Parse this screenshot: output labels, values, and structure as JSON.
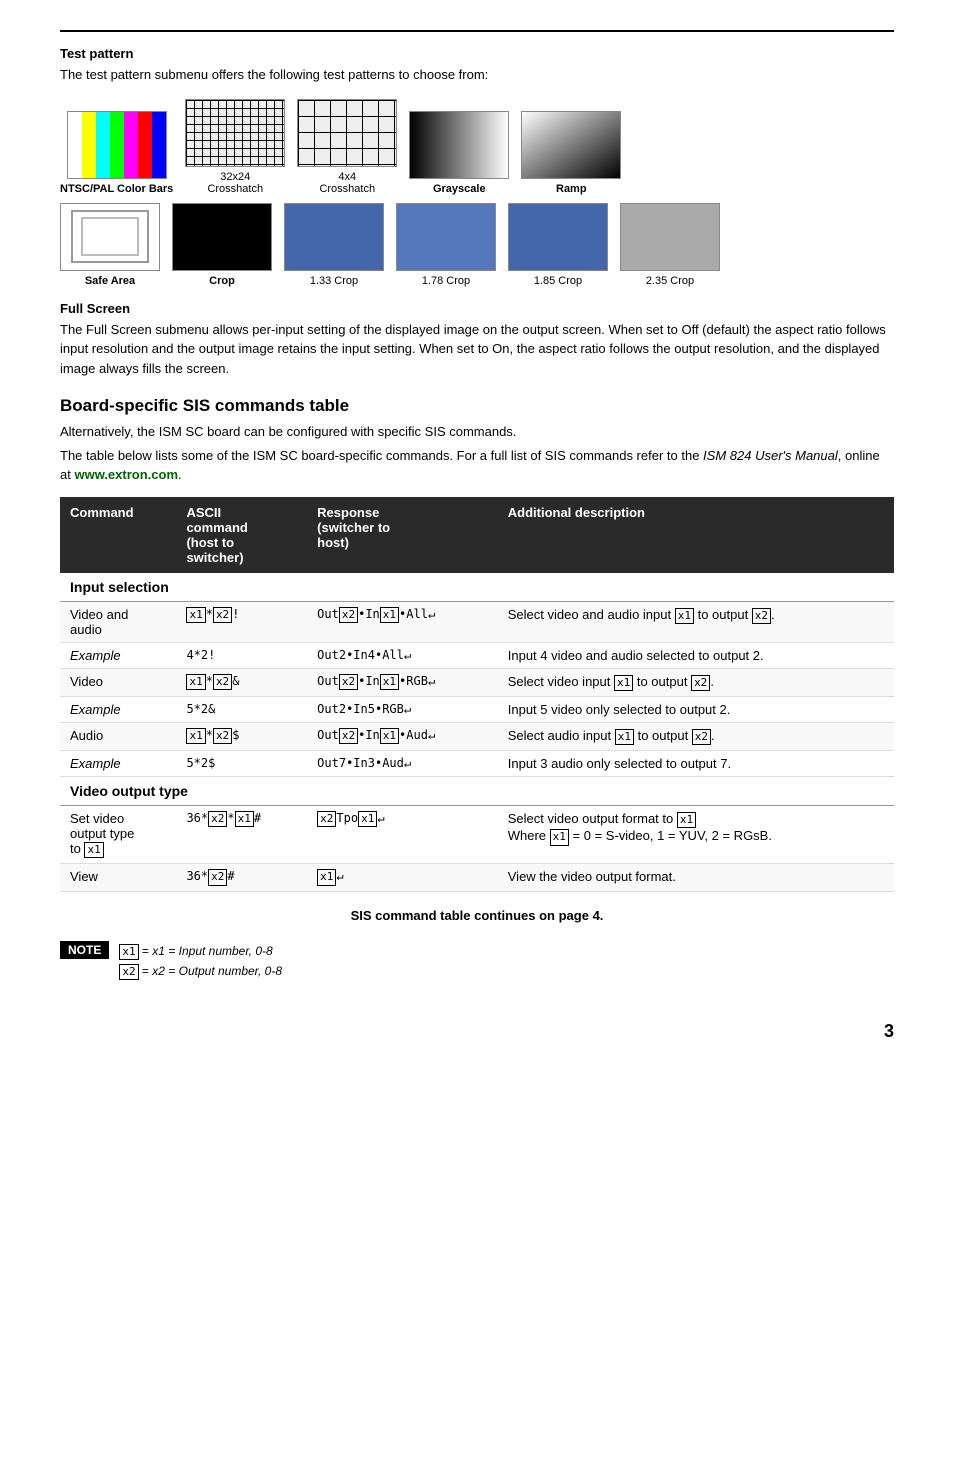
{
  "page": {
    "number": "3"
  },
  "test_pattern_section": {
    "title": "Test pattern",
    "intro": "The test pattern submenu offers the following test patterns to choose from:",
    "patterns_row1": [
      {
        "label": "NTSC/PAL Color Bars",
        "type": "color-bars",
        "bold": true
      },
      {
        "label": "32x24 Crosshatch",
        "type": "crosshatch-32",
        "bold": false
      },
      {
        "label": "4x4 Crosshatch",
        "type": "crosshatch-4",
        "bold": false
      },
      {
        "label": "Grayscale",
        "type": "grayscale",
        "bold": true
      },
      {
        "label": "Ramp",
        "type": "ramp",
        "bold": true
      }
    ],
    "patterns_row2": [
      {
        "label": "Safe Area",
        "type": "safe-area",
        "bold": true
      },
      {
        "label": "Crop",
        "type": "crop-black",
        "bold": true
      },
      {
        "label": "1.33 Crop",
        "type": "crop-133",
        "bold": false
      },
      {
        "label": "1.78 Crop",
        "type": "crop-178",
        "bold": false
      },
      {
        "label": "1.85 Crop",
        "type": "crop-185",
        "bold": false
      },
      {
        "label": "2.35 Crop",
        "type": "crop-235",
        "bold": false
      }
    ]
  },
  "full_screen_section": {
    "title": "Full Screen",
    "text": "The Full Screen submenu allows per-input setting of the displayed image on the output screen. When set to Off (default) the aspect ratio follows input resolution and the output image retains the input setting.  When set to On, the aspect ratio follows the output resolution, and the displayed image always fills the screen."
  },
  "board_section": {
    "heading": "Board-specific SIS commands table",
    "intro1": "Alternatively, the ISM SC board can be configured with specific SIS commands.",
    "intro2": "The table below lists some of the ISM SC board-specific commands.  For a full list of SIS commands refer to the ",
    "manual_italic": "ISM 824 User's Manual",
    "intro3": ", online at ",
    "link": "www.extron.com",
    "intro4": "."
  },
  "table": {
    "headers": [
      "Command",
      "ASCII command\n(host to switcher)",
      "Response\n(switcher to\nhost)",
      "Additional description"
    ],
    "header_col1": "Command",
    "header_col2": "ASCII\ncommand\n(host to\nswitcher)",
    "header_col3": "Response\n(switcher to\nhost)",
    "header_col4": "Additional description",
    "section_input": "Input selection",
    "section_video_output": "Video output type",
    "rows": [
      {
        "command": "Video and\naudio",
        "ascii": "x1*x2!",
        "response": "Outx2•Inx1•All↵",
        "desc": "Select video and audio input x1 to output x2.",
        "type": "data"
      },
      {
        "command": "Example",
        "ascii": "4*2!",
        "response": "Out2•In4•All↵",
        "desc": "Input 4 video and audio selected to output 2.",
        "type": "example"
      },
      {
        "command": "Video",
        "ascii": "x1*x2&",
        "response": "Outx2•Inx1•RGB↵",
        "desc": "Select video input x1 to output x2.",
        "type": "data"
      },
      {
        "command": "Example",
        "ascii": "5*2&",
        "response": "Out2•In5•RGB↵",
        "desc": "Input 5 video only selected to output 2.",
        "type": "example"
      },
      {
        "command": "Audio",
        "ascii": "x1*x2$",
        "response": "Outx2•Inx1•Aud↵",
        "desc": "Select audio input x1 to output x2.",
        "type": "data"
      },
      {
        "command": "Example",
        "ascii": "5*2$",
        "response": "Out7•In3•Aud↵",
        "desc": "Input 3 audio only selected to output 7.",
        "type": "example"
      }
    ],
    "video_output_rows": [
      {
        "command": "Set video\noutput type\nto x1",
        "ascii": "36*x2*x1#",
        "response": "x2Tpox1↵",
        "desc": "Select video output format to x1\nWhere x1 = 0 = S-video, 1 = YUV, 2 = RGsB.",
        "type": "data"
      },
      {
        "command": "View",
        "ascii": "36*x2#",
        "response": "x1↵",
        "desc": "View the video output format.",
        "type": "data"
      }
    ]
  },
  "continues": "SIS command table continues on page 4.",
  "note": {
    "label": "NOTE",
    "lines": [
      "x1 = Input number, 0-8",
      "x2 = Output number, 0-8"
    ]
  }
}
